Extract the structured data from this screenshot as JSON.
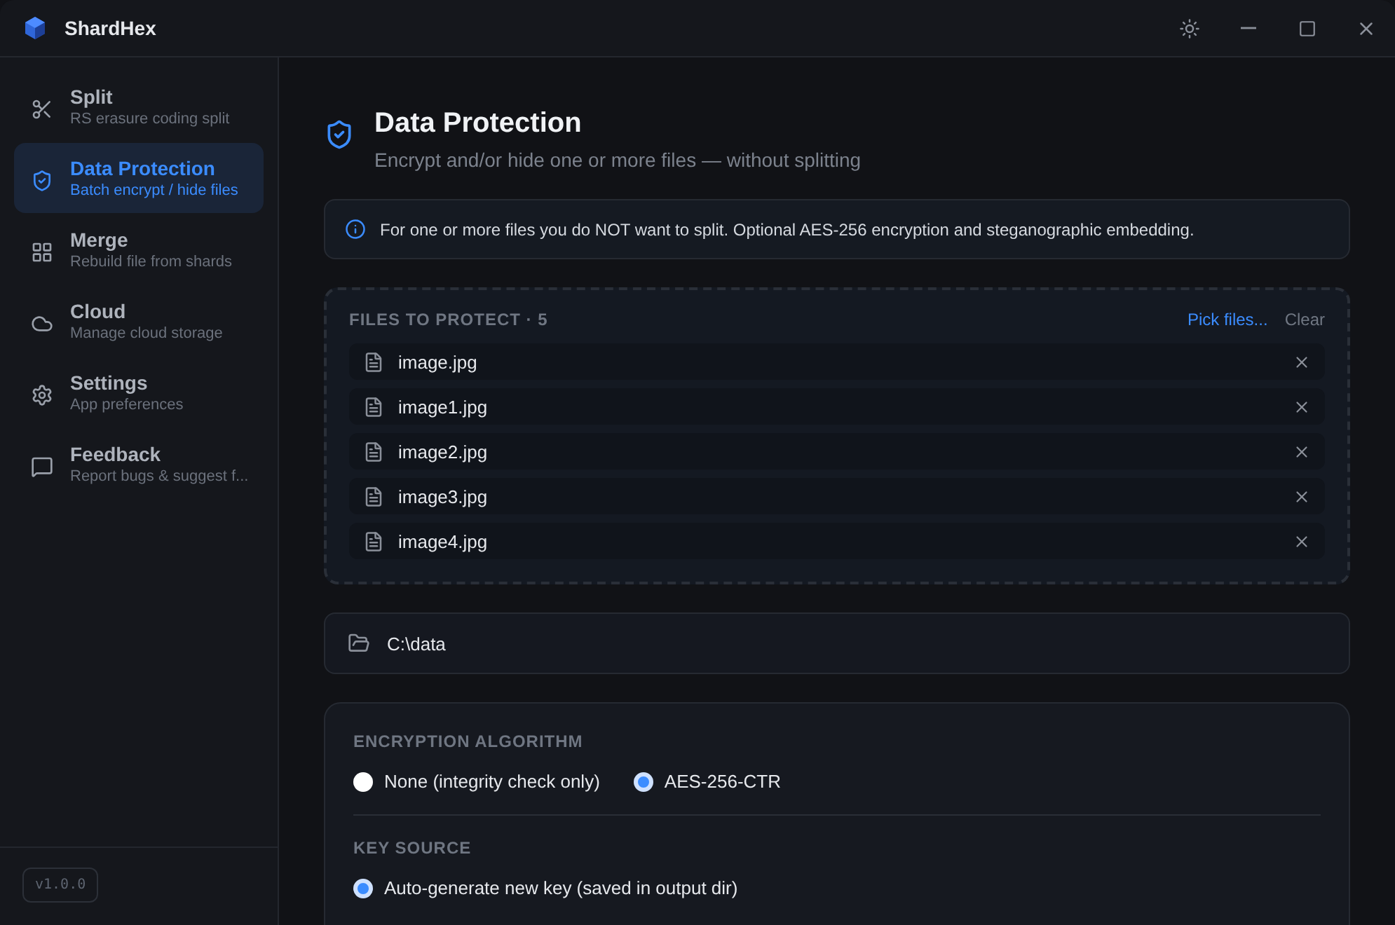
{
  "window": {
    "title": "ShardHex"
  },
  "sidebar": {
    "items": [
      {
        "kind": "split",
        "label": "Split",
        "sub": "RS erasure coding split",
        "selected": false
      },
      {
        "kind": "protect",
        "label": "Data Protection",
        "sub": "Batch encrypt / hide files",
        "selected": true
      },
      {
        "kind": "merge",
        "label": "Merge",
        "sub": "Rebuild file from shards",
        "selected": false
      },
      {
        "kind": "cloud",
        "label": "Cloud",
        "sub": "Manage cloud storage",
        "selected": false
      },
      {
        "kind": "settings",
        "label": "Settings",
        "sub": "App preferences",
        "selected": false
      },
      {
        "kind": "feedback",
        "label": "Feedback",
        "sub": "Report bugs & suggest f...",
        "selected": false
      }
    ],
    "version": "v1.0.0"
  },
  "header": {
    "title": "Data Protection",
    "subtitle": "Encrypt and/or hide one or more files — without splitting"
  },
  "info": "For one or more files you do NOT want to split. Optional AES-256 encryption and steganographic embedding.",
  "files": {
    "heading": "FILES TO PROTECT · 5",
    "pick": "Pick files...",
    "clear": "Clear",
    "items": [
      "image.jpg",
      "image1.jpg",
      "image2.jpg",
      "image3.jpg",
      "image4.jpg"
    ]
  },
  "output_dir": "C:\\data",
  "options": [
    {
      "heading": "ENCRYPTION ALGORITHM",
      "choices": [
        {
          "label": "None (integrity check only)",
          "selected": false
        },
        {
          "label": "AES-256-CTR",
          "selected": true
        }
      ]
    },
    {
      "heading": "KEY SOURCE",
      "choices": [
        {
          "label": "Auto-generate new key (saved in output dir)",
          "selected": true
        }
      ]
    }
  ]
}
